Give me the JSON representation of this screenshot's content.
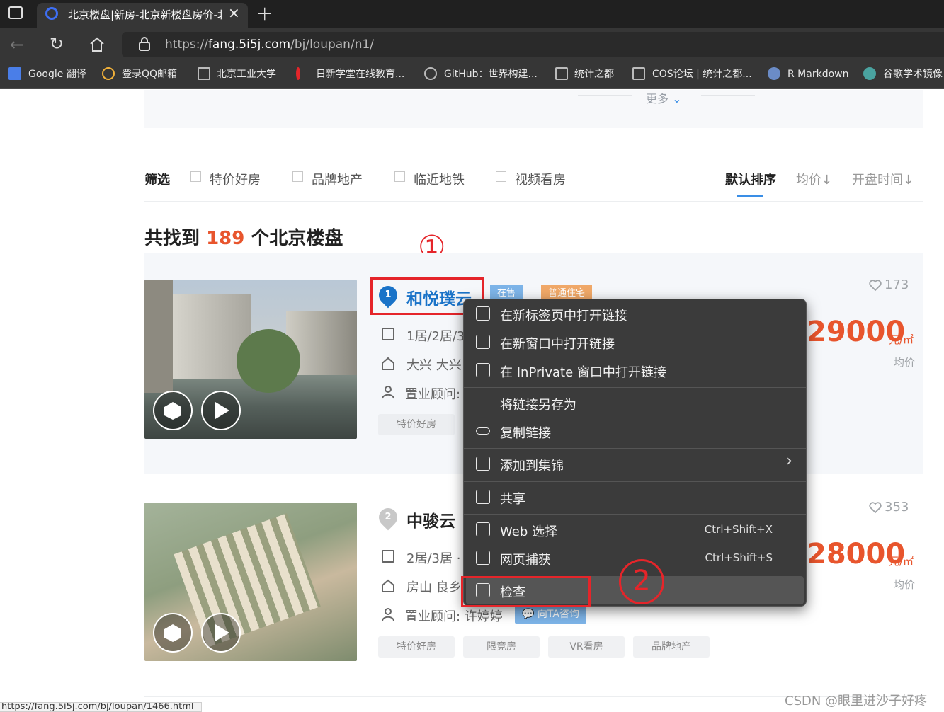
{
  "browser": {
    "tab_title": "北京楼盘|新房-北京新楼盘房价-北京",
    "new_tab_icon": "plus-icon",
    "url_prefix": "https://",
    "url_host": "fang.5i5j.com",
    "url_path": "/bj/loupan/n1/",
    "bookmarks": [
      {
        "label": "Google 翻译",
        "icon": "google-translate-icon"
      },
      {
        "label": "登录QQ邮箱",
        "icon": "qq-mail-icon"
      },
      {
        "label": "北京工业大学",
        "icon": "page-icon"
      },
      {
        "label": "日新学堂在线教育...",
        "icon": "rixin-icon"
      },
      {
        "label": "GitHub：世界构建...",
        "icon": "github-icon"
      },
      {
        "label": "统计之都",
        "icon": "page-icon"
      },
      {
        "label": "COS论坛 | 统计之都...",
        "icon": "page-icon"
      },
      {
        "label": "R Markdown",
        "icon": "r-icon"
      },
      {
        "label": "谷歌学术镜像",
        "icon": "scholar-icon"
      }
    ]
  },
  "page": {
    "more_label": "更多",
    "filter_title": "筛选",
    "filters": [
      "特价好房",
      "品牌地产",
      "临近地铁",
      "视频看房"
    ],
    "sorts": [
      {
        "label": "默认排序",
        "active": true
      },
      {
        "label": "均价",
        "arrow": "↓"
      },
      {
        "label": "开盘时间",
        "arrow": "↓"
      }
    ],
    "count_prefix": "共找到",
    "count_value": "189",
    "count_suffix": "个北京楼盘",
    "listings": [
      {
        "index": "1",
        "name": "和悦璞云",
        "badges": [
          {
            "label": "在售",
            "color": "#7db4e8"
          },
          {
            "label": "普通住宅",
            "color": "#f0a868"
          }
        ],
        "layout": "1居/2居/3",
        "location": "大兴 大兴",
        "agent_label": "置业顾问:",
        "agent_name": "",
        "tags": [
          "特价好房"
        ],
        "price": "29000",
        "unit": "元/㎡",
        "avg_label": "均价",
        "favorites": "173"
      },
      {
        "index": "2",
        "name": "中骏云",
        "layout": "2居/3居 ·",
        "location": "房山 良乡",
        "agent_label": "置业顾问:",
        "agent_name": "许婷婷",
        "consult_label": "向TA咨询",
        "tags": [
          "特价好房",
          "限竞房",
          "VR看房",
          "品牌地产"
        ],
        "price": "28000",
        "unit": "元/㎡",
        "avg_label": "均价",
        "favorites": "353"
      }
    ]
  },
  "context_menu": {
    "items": [
      {
        "label": "在新标签页中打开链接",
        "icon": "new-tab-icon"
      },
      {
        "label": "在新窗口中打开链接",
        "icon": "new-window-icon"
      },
      {
        "label": "在 InPrivate 窗口中打开链接",
        "icon": "inprivate-icon"
      },
      {
        "label": "将链接另存为",
        "icon": ""
      },
      {
        "label": "复制链接",
        "icon": "link-icon"
      },
      {
        "label": "添加到集锦",
        "icon": "collections-icon",
        "submenu": true
      },
      {
        "label": "共享",
        "icon": "share-icon"
      },
      {
        "label": "Web 选择",
        "icon": "web-select-icon",
        "shortcut": "Ctrl+Shift+X"
      },
      {
        "label": "网页捕获",
        "icon": "web-capture-icon",
        "shortcut": "Ctrl+Shift+S"
      },
      {
        "label": "检查",
        "icon": "inspect-icon",
        "highlighted": true
      }
    ]
  },
  "annotations": {
    "marker1": "①",
    "marker2": "②"
  },
  "status_bar": "https://fang.5i5j.com/bj/loupan/1466.html",
  "watermark": "CSDN @眼里进沙子好疼",
  "colors": {
    "accent_red": "#e8552d",
    "link_blue": "#1a73c8",
    "annotation_red": "#e5252a"
  }
}
